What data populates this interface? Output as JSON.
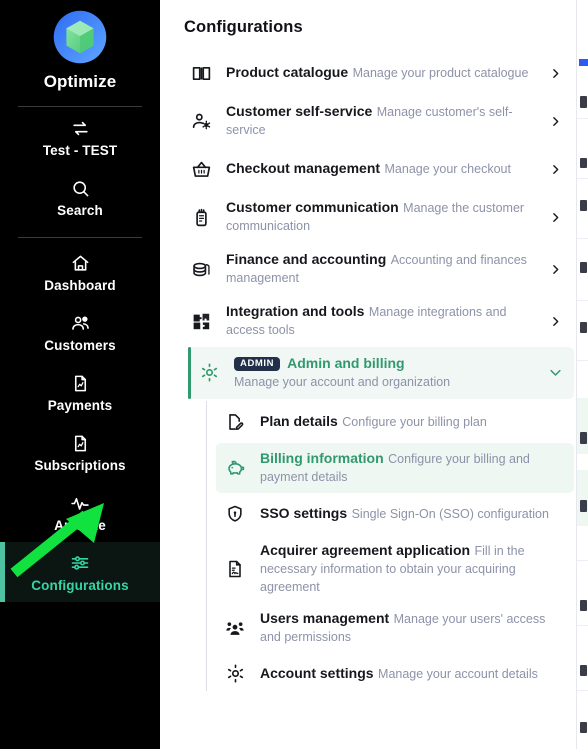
{
  "sidebar": {
    "brand": {
      "name": "Optimize",
      "logo_icon": "optimize-logo"
    },
    "account": {
      "label": "Test - TEST",
      "icon": "transfer-arrows-icon"
    },
    "search": {
      "label": "Search",
      "icon": "search-icon"
    },
    "items": [
      {
        "label": "Dashboard",
        "icon": "home-icon",
        "active": false
      },
      {
        "label": "Customers",
        "icon": "users-icon",
        "active": false
      },
      {
        "label": "Payments",
        "icon": "document-chart-icon",
        "active": false
      },
      {
        "label": "Subscriptions",
        "icon": "document-chart-icon",
        "active": false
      },
      {
        "label": "Analyze",
        "icon": "pulse-icon",
        "active": false
      },
      {
        "label": "Configurations",
        "icon": "sliders-icon",
        "active": true
      }
    ]
  },
  "main": {
    "title": "Configurations",
    "rows": [
      {
        "title": "Product catalogue",
        "subtitle": "Manage your product catalogue",
        "icon": "book-icon",
        "chevron": "chevron-right-icon"
      },
      {
        "title": "Customer self-service",
        "subtitle": "Manage customer's self-service",
        "icon": "user-gear-icon",
        "chevron": "chevron-right-icon"
      },
      {
        "title": "Checkout management",
        "subtitle": "Manage your checkout",
        "icon": "basket-icon",
        "chevron": "chevron-right-icon"
      },
      {
        "title": "Customer communication",
        "subtitle": "Manage the customer communication",
        "icon": "megaphone-icon",
        "chevron": "chevron-right-icon"
      },
      {
        "title": "Finance and accounting",
        "subtitle": "Accounting and finances management",
        "icon": "coins-icon",
        "chevron": "chevron-right-icon"
      },
      {
        "title": "Integration and tools",
        "subtitle": "Manage integrations and access tools",
        "icon": "puzzle-icon",
        "chevron": "chevron-right-icon"
      }
    ],
    "admin": {
      "badge": "ADMIN",
      "title": "Admin and billing",
      "subtitle": "Manage your account and organization",
      "icon": "gear-icon",
      "chevron": "chevron-down-icon",
      "expanded": true,
      "children": [
        {
          "title": "Plan details",
          "subtitle": "Configure your billing plan",
          "icon": "document-edit-icon",
          "selected": false
        },
        {
          "title": "Billing information",
          "subtitle": "Configure your billing and payment details",
          "icon": "piggy-bank-icon",
          "selected": true
        },
        {
          "title": "SSO settings",
          "subtitle": "Single Sign-On (SSO) configuration",
          "icon": "shield-key-icon",
          "selected": false
        },
        {
          "title": "Acquirer agreement application",
          "subtitle": "Fill in the necessary information to obtain your acquiring agreement",
          "icon": "document-signature-icon",
          "selected": false
        },
        {
          "title": "Users management",
          "subtitle": "Manage your users' access and permissions",
          "icon": "users-group-icon",
          "selected": false
        },
        {
          "title": "Account settings",
          "subtitle": "Manage your account details",
          "icon": "gear-icon",
          "selected": false
        }
      ]
    }
  },
  "annotation": {
    "type": "arrow",
    "color": "#12e23f",
    "points_to": "Billing information"
  },
  "colors": {
    "sidebar_bg": "#000000",
    "accent_green": "#31996e",
    "active_teal": "#35d6a4",
    "badge_navy": "#22304a",
    "subtitle_gray": "#8d92a8",
    "title_dark": "#16181d",
    "highlight_bg": "#f1f7f4",
    "annotation_green": "#12e23f"
  }
}
